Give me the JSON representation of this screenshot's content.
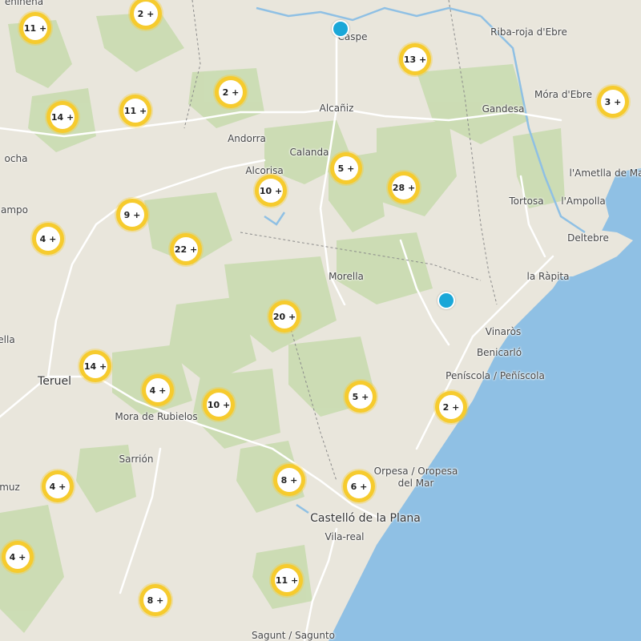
{
  "colors": {
    "cluster_ring": "#f6cb2e",
    "cluster_center": "#ffffff",
    "marker": "#1aa7d8",
    "sea": "#8fc0e4",
    "land": "#e9e6dc",
    "forest": "#c9dcb0",
    "road": "#ffffff",
    "boundary": "#8a8a8a"
  },
  "place_labels": [
    "Caspe",
    "Riba-roja d'Ebre",
    "Alcañiz",
    "Gandesa",
    "Móra d'Ebre",
    "Andorra",
    "Calanda",
    "Alcorisa",
    "l'Ametlla de Ma",
    "Tortosa",
    "l'Ampolla",
    "Deltebre",
    "la Ràpita",
    "Morella",
    "Vinaròs",
    "Benicarló",
    "Peníscola / Peñíscola",
    "Teruel",
    "Mora de Rubielos",
    "Sarrión",
    "Orpesa / Oropesa del Mar",
    "Castelló de la Plana",
    "Vila-real",
    "Sagunt / Sagunto",
    "ochа",
    "ampo",
    "ella",
    "muz",
    "eninena"
  ],
  "clusters": [
    {
      "label": "11 +"
    },
    {
      "label": "2 +"
    },
    {
      "label": "13 +"
    },
    {
      "label": "2 +"
    },
    {
      "label": "3 +"
    },
    {
      "label": "14 +"
    },
    {
      "label": "11 +"
    },
    {
      "label": "5 +"
    },
    {
      "label": "28 +"
    },
    {
      "label": "10 +"
    },
    {
      "label": "9 +"
    },
    {
      "label": "4 +"
    },
    {
      "label": "22 +"
    },
    {
      "label": "20 +"
    },
    {
      "label": "14 +"
    },
    {
      "label": "4 +"
    },
    {
      "label": "10 +"
    },
    {
      "label": "5 +"
    },
    {
      "label": "2 +"
    },
    {
      "label": "4 +"
    },
    {
      "label": "8 +"
    },
    {
      "label": "6 +"
    },
    {
      "label": "4 +"
    },
    {
      "label": "11 +"
    },
    {
      "label": "8 +"
    }
  ],
  "markers": [
    {
      "name": "location-marker"
    },
    {
      "name": "location-marker"
    }
  ]
}
